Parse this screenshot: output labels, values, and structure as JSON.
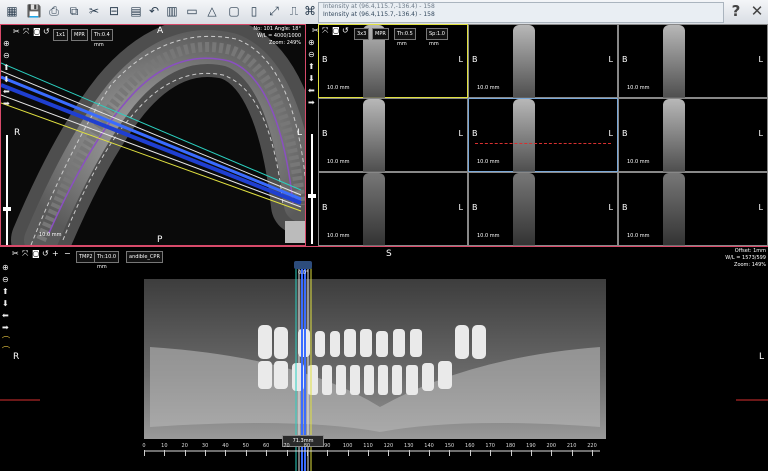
{
  "toolbar": {
    "icons": [
      "dental-chart-icon",
      "save-icon",
      "print-icon",
      "capture-icon",
      "settings-icon",
      "ruler-icon",
      "document-icon",
      "export-icon",
      "undo-icon",
      "layout-icon",
      "preset-icon",
      "nerve-icon",
      "warning-icon",
      "clipboard-icon",
      "copy-icon",
      "fullscreen-icon",
      "implant-icon",
      "grid-icon",
      "tooth-icon",
      "cursor-icon"
    ],
    "help_label": "?",
    "close_label": "✕"
  },
  "infobar": {
    "line1": "Intensity at (96.4,115.7,-136.4) - 158",
    "line2": "Intensity at (96.4,115.7,-136.4) - 158"
  },
  "axial": {
    "toolbar": {
      "layout": "1x1",
      "mode": "MPR",
      "thickness": "Th:0.4 mm"
    },
    "orient_top": "A",
    "orient_bottom": "P",
    "orient_left": "R",
    "orient_right": "L",
    "info": [
      "No: 101 Angle: 18°",
      "W/L = 4000/1000",
      "Zoom: 249%"
    ],
    "scale": "10.0 mm"
  },
  "cross": {
    "toolbar": {
      "layout": "3x3",
      "mode": "MPR",
      "thickness": "Th:0.5 mm",
      "spacing": "Sp:1.0 mm"
    },
    "left_label": "B",
    "right_label": "L",
    "scale": "10.0 mm",
    "cells": 9
  },
  "pano": {
    "toolbar": {
      "preset": "TMP2",
      "thickness": "Th:10.0 mm",
      "curve": "andible_CPR"
    },
    "orient_top": "S",
    "orient_left": "R",
    "orient_right": "L",
    "info": [
      "Offset: 1mm",
      "W/L = 1573/599",
      "Zoom: 149%"
    ],
    "slider_value": "0.0°",
    "cursor_value": "71.3mm",
    "ruler_ticks": [
      "0",
      "10",
      "20",
      "30",
      "40",
      "50",
      "60",
      "70",
      "80",
      "90",
      "100",
      "110",
      "120",
      "130",
      "140",
      "150",
      "160",
      "170",
      "180",
      "190",
      "200",
      "210",
      "220"
    ]
  }
}
